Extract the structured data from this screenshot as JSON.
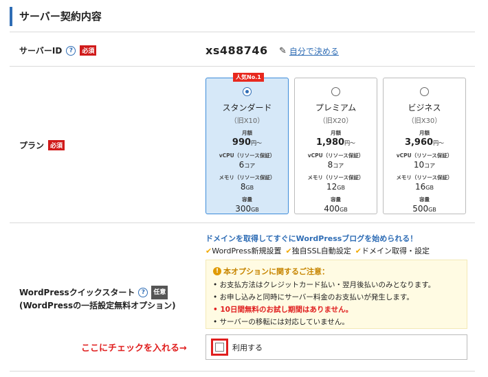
{
  "section": {
    "title": "サーバー契約内容"
  },
  "server_id": {
    "label": "サーバーID",
    "required": "必須",
    "value": "xs488746",
    "edit_link": "自分で決める"
  },
  "plan": {
    "label": "プラン",
    "required": "必須",
    "cards": [
      {
        "selected": true,
        "badge": "人気No.1",
        "name": "スタンダード",
        "old": "（旧X10）",
        "price_label": "月額",
        "price": "990",
        "price_unit": "円〜",
        "vcpu_label": "vCPU（リソース保証）",
        "vcpu": "6",
        "vcpu_unit": "コア",
        "mem_label": "メモリ（リソース保証）",
        "mem": "8",
        "mem_unit": "GB",
        "disk_label": "容量",
        "disk": "300",
        "disk_unit": "GB"
      },
      {
        "selected": false,
        "badge": "",
        "name": "プレミアム",
        "old": "（旧X20）",
        "price_label": "月額",
        "price": "1,980",
        "price_unit": "円〜",
        "vcpu_label": "vCPU（リソース保証）",
        "vcpu": "8",
        "vcpu_unit": "コア",
        "mem_label": "メモリ（リソース保証）",
        "mem": "12",
        "mem_unit": "GB",
        "disk_label": "容量",
        "disk": "400",
        "disk_unit": "GB"
      },
      {
        "selected": false,
        "badge": "",
        "name": "ビジネス",
        "old": "（旧X30）",
        "price_label": "月額",
        "price": "3,960",
        "price_unit": "円〜",
        "vcpu_label": "vCPU（リソース保証）",
        "vcpu": "10",
        "vcpu_unit": "コア",
        "mem_label": "メモリ（リソース保証）",
        "mem": "16",
        "mem_unit": "GB",
        "disk_label": "容量",
        "disk": "500",
        "disk_unit": "GB"
      }
    ]
  },
  "wp_quickstart": {
    "label_line1": "WordPressクイックスタート",
    "label_line2": "(WordPressの一括設定無料オプション)",
    "optional": "任意",
    "headline": "ドメインを取得してすぐにWordPressブログを始められる！",
    "features": [
      "WordPress新規設置",
      "独自SSL自動設定",
      "ドメイン取得・設定"
    ],
    "notice_title": "本オプションに関するご注意：",
    "notices": [
      "お支払方法はクレジットカード払い・翌月後払いのみとなります。",
      "お申し込みと同時にサーバー料金のお支払いが発生します。",
      "10日間無料のお試し期間はありません。",
      "サーバーの移転には対応していません。"
    ],
    "checkbox_label": "利用する",
    "annotation": "ここにチェックを入れる→"
  }
}
